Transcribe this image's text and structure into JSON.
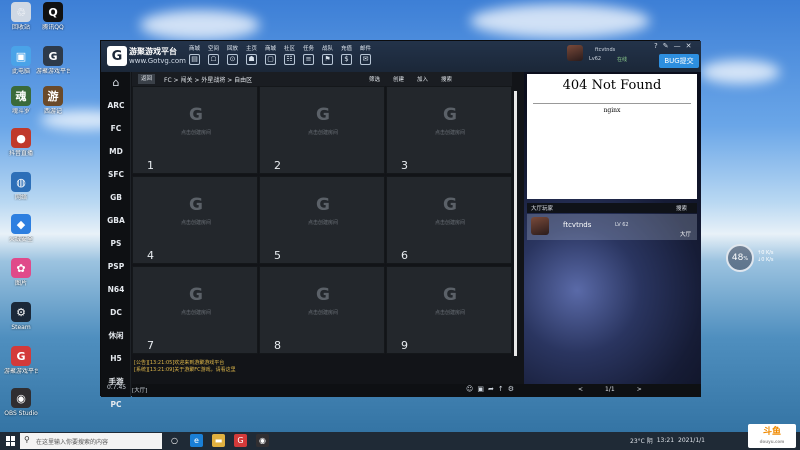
{
  "desktop": {
    "icons": [
      {
        "label": "回收站",
        "glyph": "♲",
        "color": "#cfd8e4"
      },
      {
        "label": "腾讯QQ",
        "glyph": "Q",
        "color": "#111111"
      },
      {
        "label": "此电脑",
        "glyph": "▣",
        "color": "#4aa3e8"
      },
      {
        "label": "游聚游戏平台",
        "glyph": "G",
        "color": "#2d3a4a"
      },
      {
        "label": "魂斗罗",
        "glyph": "魂",
        "color": "#3a6a3a"
      },
      {
        "label": "西游记",
        "glyph": "游",
        "color": "#6a4a2a"
      },
      {
        "label": "抖音直播",
        "glyph": "●",
        "color": "#c0392b"
      },
      {
        "label": "网络",
        "glyph": "◍",
        "color": "#2d6fb8"
      },
      {
        "label": "火绒安全",
        "glyph": "◆",
        "color": "#2d7fe0"
      },
      {
        "label": "图片",
        "glyph": "✿",
        "color": "#e04a8a"
      },
      {
        "label": "Steam",
        "glyph": "⚙",
        "color": "#1b2838"
      },
      {
        "label": "游聚游戏平台",
        "glyph": "G",
        "color": "#d33a3a"
      },
      {
        "label": "OBS Studio",
        "glyph": "◉",
        "color": "#302e31"
      }
    ]
  },
  "app": {
    "brand": "游聚游戏平台",
    "brand_url": "www.Gotvg.com",
    "nav": [
      {
        "label": "商城",
        "icon": "store-icon",
        "glyph": "▤"
      },
      {
        "label": "空间",
        "icon": "space-icon",
        "glyph": "☖"
      },
      {
        "label": "回放",
        "icon": "replay-icon",
        "glyph": "⊙"
      },
      {
        "label": "主页",
        "icon": "home-icon",
        "glyph": "☗"
      },
      {
        "label": "商城",
        "icon": "shop-icon",
        "glyph": "▢"
      },
      {
        "label": "社区",
        "icon": "community-icon",
        "glyph": "☷"
      },
      {
        "label": "任务",
        "icon": "task-icon",
        "glyph": "≡"
      },
      {
        "label": "战队",
        "icon": "team-icon",
        "glyph": "⚑"
      },
      {
        "label": "充值",
        "icon": "recharge-icon",
        "glyph": "$"
      },
      {
        "label": "邮件",
        "icon": "mail-icon",
        "glyph": "✉"
      }
    ],
    "user": {
      "name": "ftcvtnds",
      "level": "Lv62",
      "status": "在线"
    },
    "window_controls": [
      "?",
      "✎",
      "—",
      "✕"
    ],
    "bug_button": "BUG提交",
    "sidebar": {
      "categories": [
        "ARC",
        "FC",
        "MD",
        "SFC",
        "GB",
        "GBA",
        "PS",
        "PSP",
        "N64",
        "DC",
        "休闲",
        "H5",
        "手游",
        "PC"
      ],
      "version": "0.7.45"
    },
    "breadcrumb": {
      "back": "返回",
      "path": "FC > 闯关 > 外星战将 > 自由区"
    },
    "tools": [
      "筛选",
      "创建",
      "加入",
      "搜索"
    ],
    "rooms": [
      {
        "number": "1",
        "hint": "点击创建房间"
      },
      {
        "number": "2",
        "hint": "点击创建房间"
      },
      {
        "number": "3",
        "hint": "点击创建房间"
      },
      {
        "number": "4",
        "hint": "点击创建房间"
      },
      {
        "number": "5",
        "hint": "点击创建房间"
      },
      {
        "number": "6",
        "hint": "点击创建房间"
      },
      {
        "number": "7",
        "hint": "点击创建房间"
      },
      {
        "number": "8",
        "hint": "点击创建房间"
      },
      {
        "number": "9",
        "hint": "点击创建房间"
      }
    ],
    "chat": [
      "[公告][13:21:05]欢迎来到游聚游戏平台",
      "[系统][13:21:09]关于游聚FC游戏，请看这里"
    ],
    "bottom": {
      "input_label": "[大厅]",
      "page": "1/1",
      "prev": "<",
      "next": ">"
    },
    "not_found": {
      "title": "404 Not Found",
      "server": "nginx"
    },
    "lobby": {
      "header_left": "大厅玩家",
      "header_right": "搜索",
      "players": [
        {
          "name": "ftcvtnds",
          "level": "LV 62",
          "room": "大厅"
        }
      ]
    }
  },
  "widget": {
    "value": "48",
    "unit": "%",
    "side": [
      "↑0 K/s",
      "↓0 K/s"
    ]
  },
  "taskbar": {
    "search_placeholder": "在这里输入你要搜索的内容",
    "apps": [
      {
        "name": "task-view",
        "glyph": "○",
        "color": "#1f2a36"
      },
      {
        "name": "edge",
        "glyph": "e",
        "color": "#1a7fd6"
      },
      {
        "name": "explorer",
        "glyph": "▬",
        "color": "#e0b040"
      },
      {
        "name": "gotvg",
        "glyph": "G",
        "color": "#d33a3a"
      },
      {
        "name": "obs",
        "glyph": "◉",
        "color": "#302e31"
      }
    ],
    "tray": {
      "weather": "23°C 阴",
      "time": "13:21",
      "date": "2021/1/1"
    }
  },
  "watermark": {
    "brand": "斗鱼",
    "url": "douyu.com"
  }
}
